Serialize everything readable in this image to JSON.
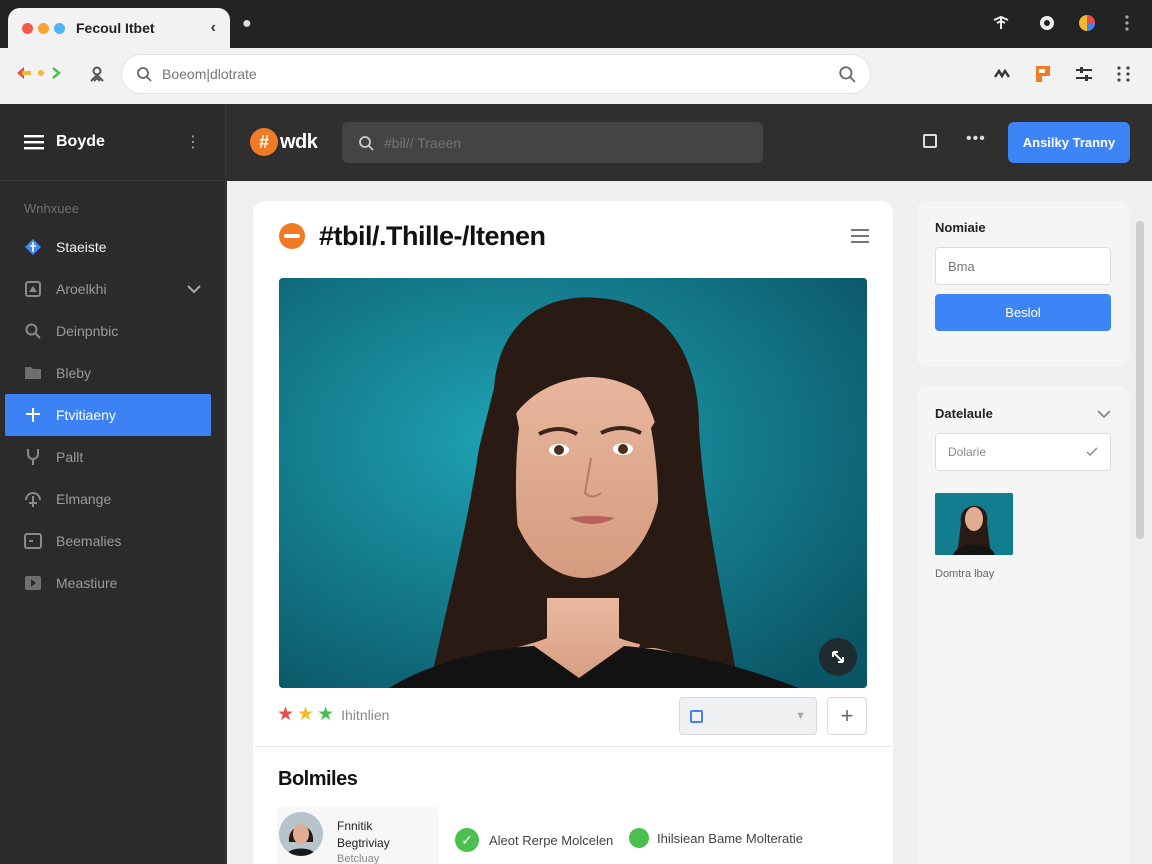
{
  "browser": {
    "tab_title": "Fecoul Itbet",
    "tab_close": "‹",
    "address_placeholder": "Boeom|dlotrate"
  },
  "sidebar": {
    "title": "Boyde",
    "section_label": "Wnhxuee",
    "items": [
      {
        "label": "Staeiste",
        "icon": "diamond-icon"
      },
      {
        "label": "Aroelkhi",
        "icon": "monitor-icon",
        "has_chevron": true
      },
      {
        "label": "Deinpnbic",
        "icon": "magnifier-icon"
      },
      {
        "label": "Bleby",
        "icon": "folder-icon"
      },
      {
        "label": "Ftvitiaeny",
        "icon": "plus-icon",
        "active": true
      },
      {
        "label": "Pallt",
        "icon": "fork-icon"
      },
      {
        "label": "Elmange",
        "icon": "tree-icon"
      },
      {
        "label": "Beemalies",
        "icon": "terminal-icon"
      },
      {
        "label": "Meastiure",
        "icon": "play-icon"
      }
    ]
  },
  "header": {
    "logo_text": "wdk",
    "logo_mark": "#",
    "search_placeholder": "#bil// Traeen",
    "primary_button": "Ansilky Tranny"
  },
  "main": {
    "title": "#tbil/.Thille-/ltenen",
    "rating_label": "Ihitnlien",
    "stars": [
      "#e84b4b",
      "#f2b82e",
      "#4cbd4f"
    ],
    "section_title": "Bolmiles",
    "profile": {
      "name_line1": "Fnnitik",
      "name_line2": "Begtriviay",
      "sub": "Betcluay"
    },
    "statuses": [
      "Aleot Rerpe Molcelen",
      "Ihilsiean Bame Molteratie"
    ]
  },
  "right_panel": {
    "label": "Nomiaie",
    "input_placeholder": "Bma",
    "button": "Beslol"
  },
  "right_panel2": {
    "label": "Datelaule",
    "select_value": "Dolarie",
    "thumbnail_caption": "Domtra lbay"
  },
  "colors": {
    "accent": "#3d85f6",
    "brand_orange": "#f07a26",
    "success": "#4cc04f"
  }
}
